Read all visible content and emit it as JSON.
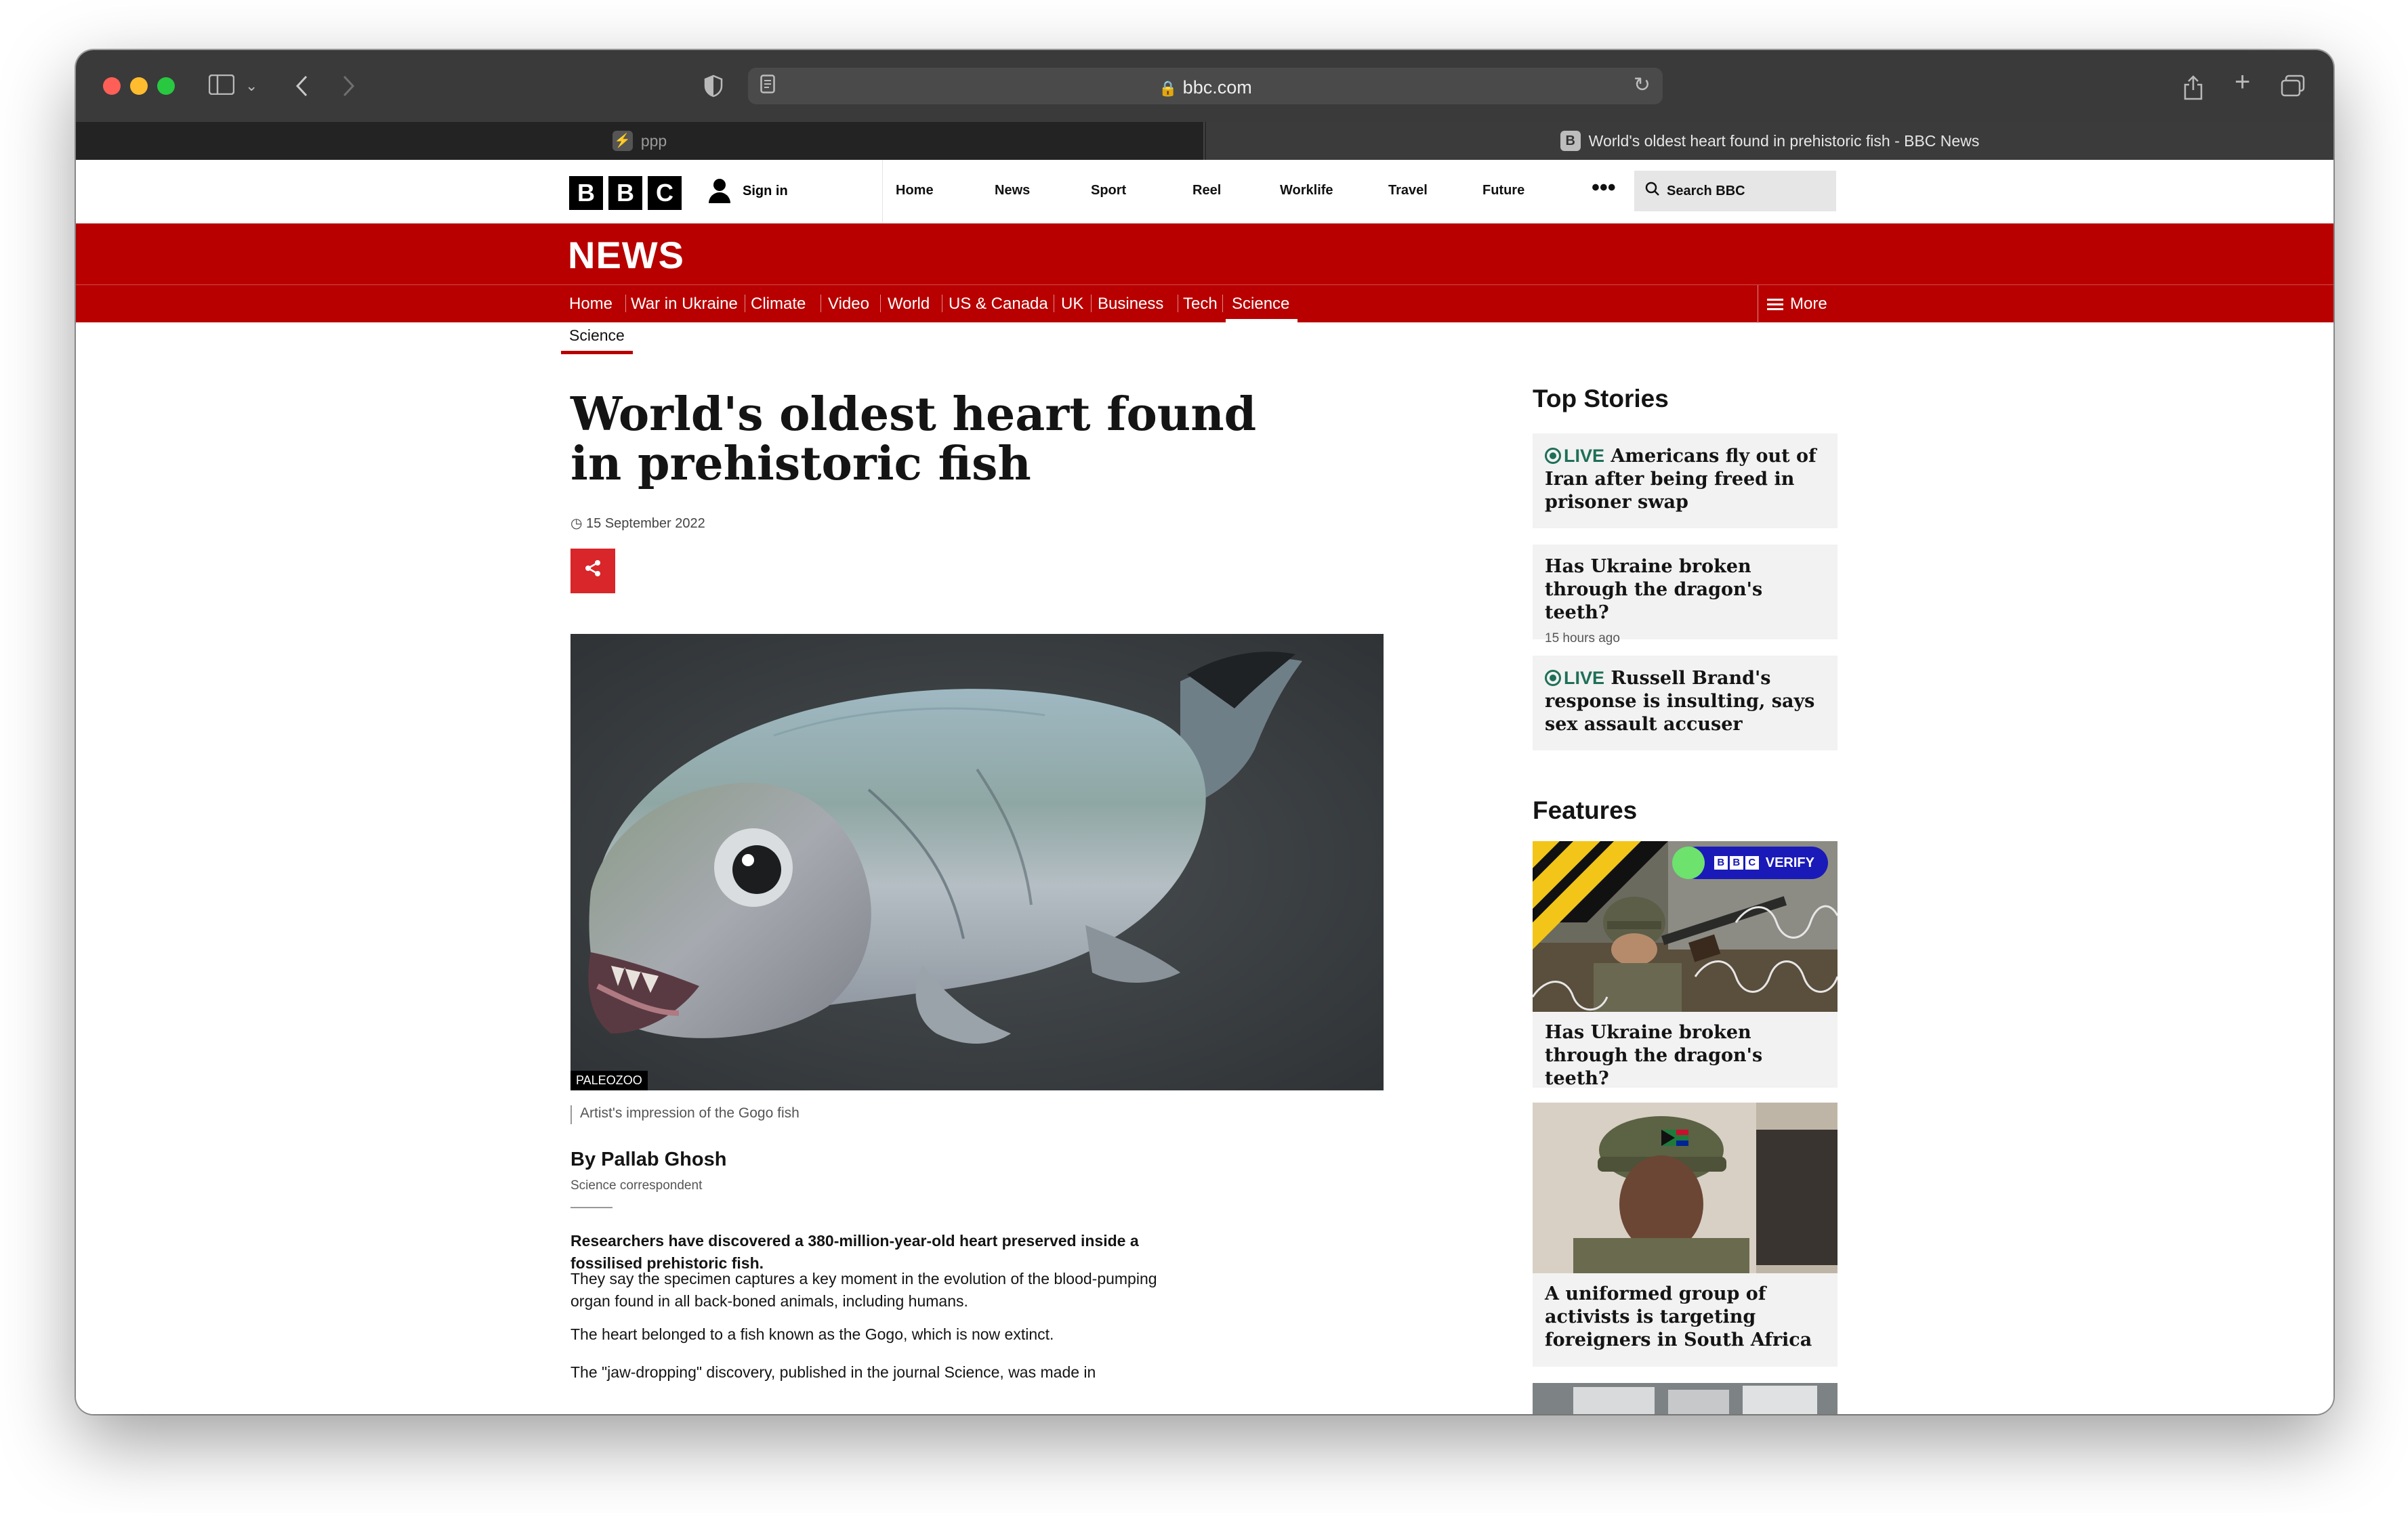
{
  "browser": {
    "url": "bbc.com",
    "tabs": [
      {
        "label": "ppp",
        "favicon": "bolt-icon"
      },
      {
        "label": "World's oldest heart found in prehistoric fish - BBC News",
        "favicon": "B"
      }
    ]
  },
  "bbc_header": {
    "logo": [
      "B",
      "B",
      "C"
    ],
    "signin": "Sign in",
    "nav": [
      "Home",
      "News",
      "Sport",
      "Reel",
      "Worklife",
      "Travel",
      "Future"
    ],
    "more": "•••",
    "search_placeholder": "Search BBC"
  },
  "news_bar": {
    "title": "NEWS",
    "sections": [
      "Home",
      "War in Ukraine",
      "Climate",
      "Video",
      "World",
      "US & Canada",
      "UK",
      "Business",
      "Tech",
      "Science"
    ],
    "active_section": "Science",
    "more": "More"
  },
  "article": {
    "subsection": "Science",
    "headline": "World's oldest heart found in prehistoric fish",
    "date": "15 September 2022",
    "image_credit": "PALEOZOO",
    "image_caption": "Artist's impression of the Gogo fish",
    "byline": "By Pallab Ghosh",
    "role": "Science correspondent",
    "paragraphs": [
      "Researchers have discovered a 380-million-year-old heart preserved inside a fossilised prehistoric fish.",
      "They say the specimen captures a key moment in the evolution of the blood-pumping organ found in all back-boned animals, including humans.",
      "The heart belonged to a fish known as the Gogo, which is now extinct.",
      "The \"jaw-dropping\" discovery, published in the journal Science, was made in"
    ]
  },
  "top_stories": {
    "heading": "Top Stories",
    "items": [
      {
        "live": "LIVE",
        "title": "Americans fly out of Iran after being freed in prisoner swap",
        "time": ""
      },
      {
        "live": "",
        "title": "Has Ukraine broken through the dragon's teeth?",
        "time": "15 hours ago"
      },
      {
        "live": "LIVE",
        "title": "Russell Brand's response is insulting, says sex assault accuser",
        "time": ""
      }
    ]
  },
  "features": {
    "heading": "Features",
    "verify_badge": {
      "logo": [
        "B",
        "B",
        "C"
      ],
      "label": "VERIFY"
    },
    "items": [
      {
        "title": "Has Ukraine broken through the dragon's teeth?"
      },
      {
        "title": "A uniformed group of activists is targeting foreigners in South Africa"
      }
    ]
  },
  "colors": {
    "news_red": "#b80000",
    "live_green": "#1f6f58",
    "share_red": "#d8262a"
  }
}
